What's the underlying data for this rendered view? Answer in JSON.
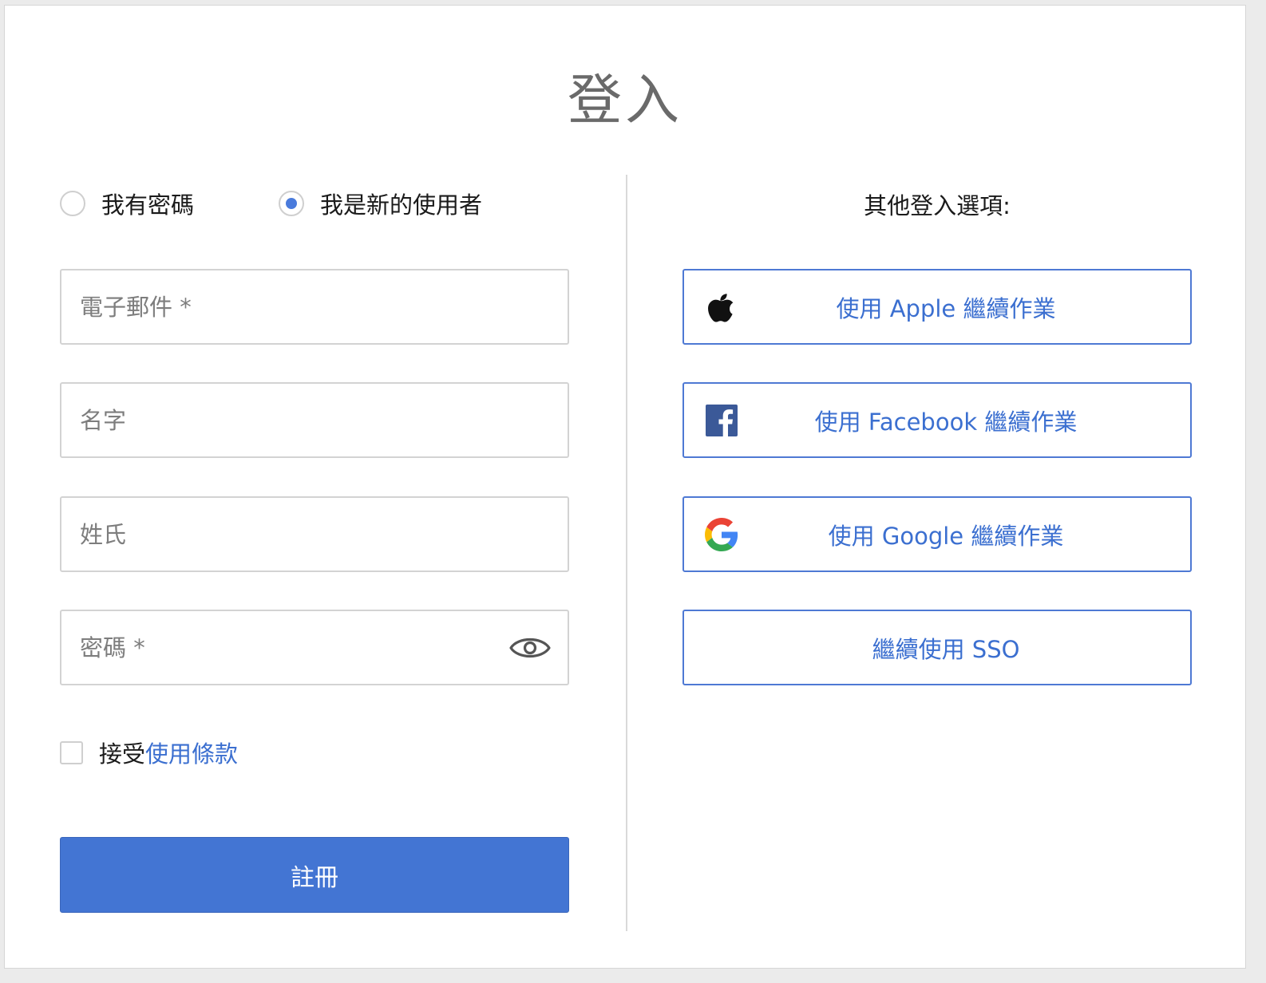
{
  "page": {
    "title": "登入"
  },
  "mode": {
    "options": [
      {
        "label": "我有密碼",
        "selected": false
      },
      {
        "label": "我是新的使用者",
        "selected": true
      }
    ]
  },
  "form": {
    "email_placeholder": "電子郵件 *",
    "first_name_placeholder": "名字",
    "last_name_placeholder": "姓氏",
    "password_placeholder": "密碼 *",
    "password_toggle_icon": "eye-icon",
    "terms_prefix": "接受",
    "terms_link": "使用條款",
    "terms_checked": false,
    "submit_label": "註冊"
  },
  "other_options": {
    "heading": "其他登入選項:",
    "buttons": [
      {
        "label": "使用 Apple 繼續作業",
        "icon": "apple-icon"
      },
      {
        "label": "使用 Facebook 繼續作業",
        "icon": "facebook-icon"
      },
      {
        "label": "使用 Google 繼續作業",
        "icon": "google-icon"
      },
      {
        "label": "繼續使用 SSO",
        "icon": ""
      }
    ]
  },
  "colors": {
    "accent": "#4375d3",
    "link": "#3b6fd0",
    "facebook": "#3b5998",
    "border": "#d3d3d3"
  }
}
